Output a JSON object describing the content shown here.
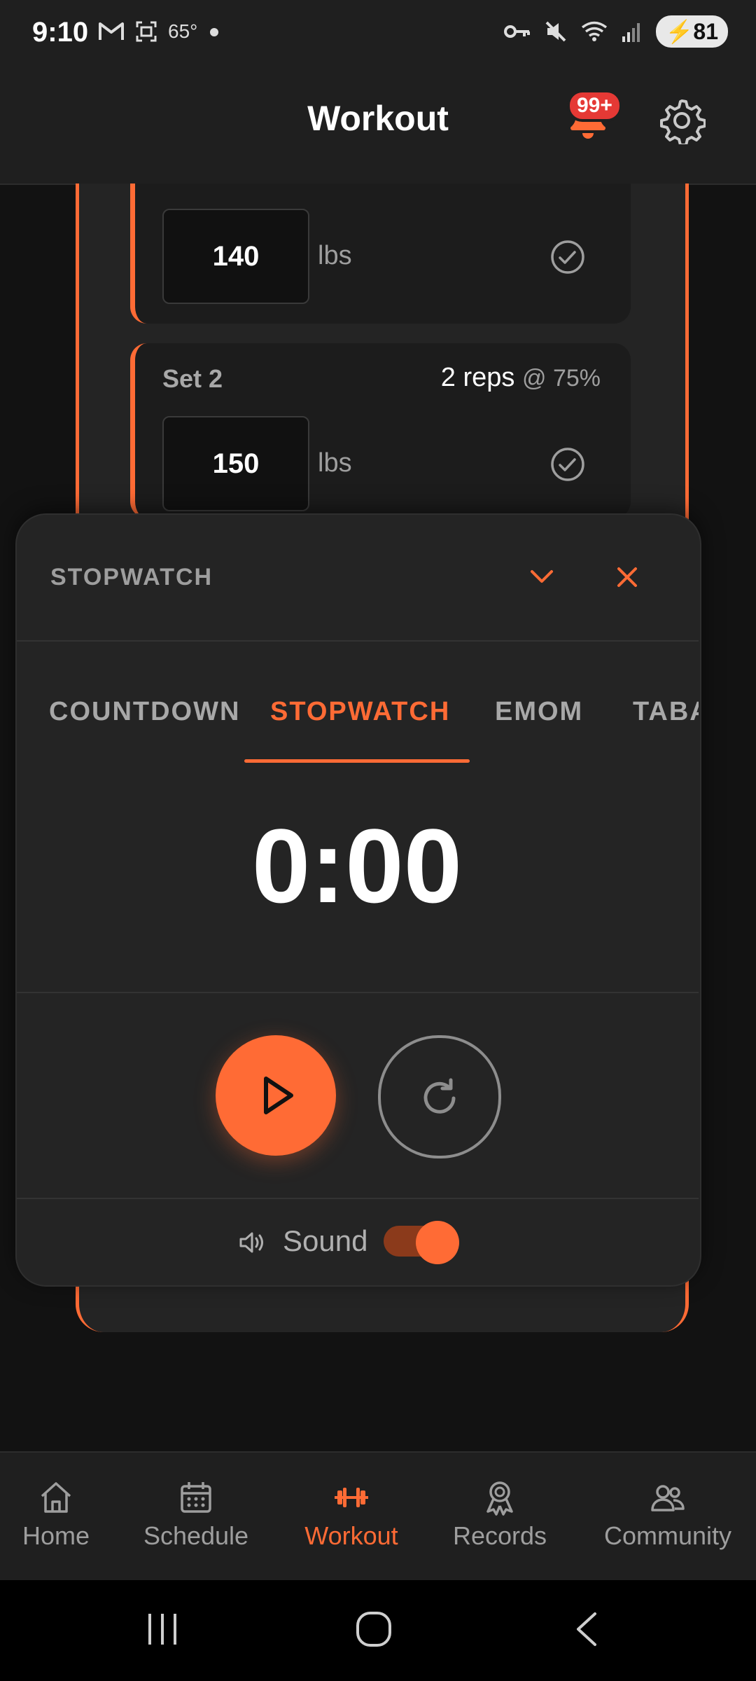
{
  "status_bar": {
    "time": "9:10",
    "temperature": "65°",
    "battery": "81"
  },
  "header": {
    "title": "Workout",
    "notification_badge": "99+"
  },
  "sets": [
    {
      "weight": "140",
      "unit": "lbs"
    },
    {
      "label": "Set 2",
      "reps": "2 reps",
      "percent": "@ 75%",
      "weight": "150",
      "unit": "lbs"
    }
  ],
  "timer_panel": {
    "title": "STOPWATCH",
    "tabs": [
      {
        "label": "COUNTDOWN",
        "active": false
      },
      {
        "label": "STOPWATCH",
        "active": true
      },
      {
        "label": "EMOM",
        "active": false
      },
      {
        "label": "TABATA",
        "active": false
      }
    ],
    "time": "0:00",
    "sound_label": "Sound",
    "sound_on": true
  },
  "bottom_nav": [
    {
      "label": "Home",
      "icon": "home-icon",
      "active": false
    },
    {
      "label": "Schedule",
      "icon": "calendar-icon",
      "active": false
    },
    {
      "label": "Workout",
      "icon": "dumbbell-icon",
      "active": true
    },
    {
      "label": "Records",
      "icon": "award-icon",
      "active": false
    },
    {
      "label": "Community",
      "icon": "people-icon",
      "active": false
    }
  ],
  "colors": {
    "accent": "#ff6b35",
    "background": "#121212",
    "surface": "#242424",
    "badge": "#e53935"
  }
}
